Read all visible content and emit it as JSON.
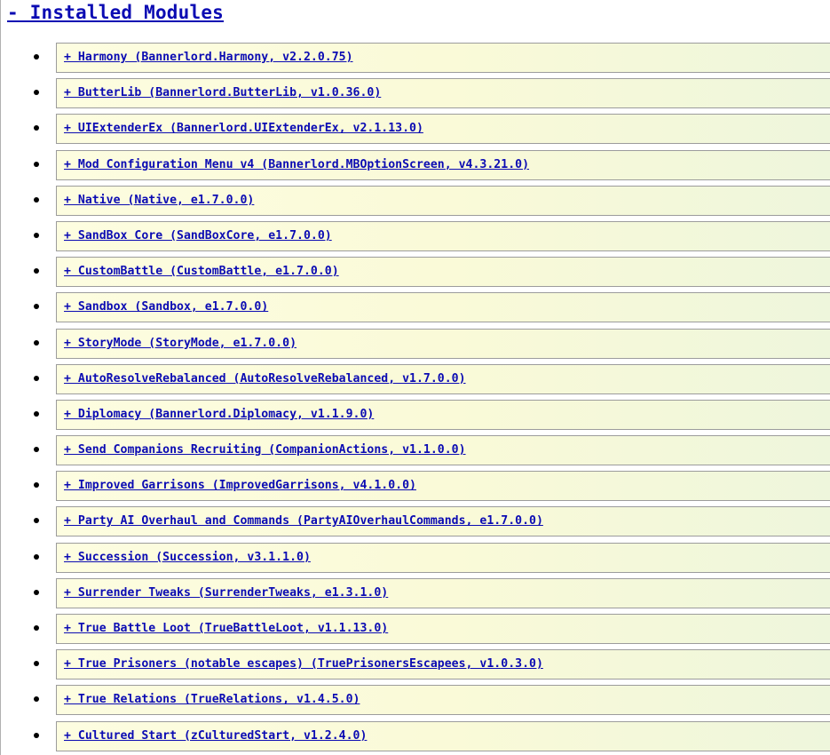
{
  "section": {
    "title": "- Installed Modules"
  },
  "modules": [
    {
      "label": "+ Harmony (Bannerlord.Harmony, v2.2.0.75)"
    },
    {
      "label": "+ ButterLib (Bannerlord.ButterLib, v1.0.36.0)"
    },
    {
      "label": "+ UIExtenderEx (Bannerlord.UIExtenderEx, v2.1.13.0)"
    },
    {
      "label": "+ Mod Configuration Menu v4 (Bannerlord.MBOptionScreen, v4.3.21.0)"
    },
    {
      "label": "+ Native (Native, e1.7.0.0)"
    },
    {
      "label": "+ SandBox Core (SandBoxCore, e1.7.0.0)"
    },
    {
      "label": "+ CustomBattle (CustomBattle, e1.7.0.0)"
    },
    {
      "label": "+ Sandbox (Sandbox, e1.7.0.0)"
    },
    {
      "label": "+ StoryMode (StoryMode, e1.7.0.0)"
    },
    {
      "label": "+ AutoResolveRebalanced (AutoResolveRebalanced, v1.7.0.0)"
    },
    {
      "label": "+ Diplomacy (Bannerlord.Diplomacy, v1.1.9.0)"
    },
    {
      "label": "+ Send Companions Recruiting (CompanionActions, v1.1.0.0)"
    },
    {
      "label": "+ Improved Garrisons (ImprovedGarrisons, v4.1.0.0)"
    },
    {
      "label": "+ Party AI Overhaul and Commands (PartyAIOverhaulCommands, e1.7.0.0)"
    },
    {
      "label": "+ Succession (Succession, v3.1.1.0)"
    },
    {
      "label": "+ Surrender Tweaks (SurrenderTweaks, e1.3.1.0)"
    },
    {
      "label": "+ True Battle Loot (TrueBattleLoot, v1.1.13.0)"
    },
    {
      "label": "+ True Prisoners (notable escapes) (TruePrisonersEscapees, v1.0.3.0)"
    },
    {
      "label": "+ True Relations (TrueRelations, v1.4.5.0)"
    },
    {
      "label": "+ Cultured Start (zCulturedStart, v1.2.4.0)"
    }
  ],
  "colors": {
    "link": "#0b0bb3",
    "box_bg": "#fafad8",
    "box_border": "#9c9c9c"
  }
}
